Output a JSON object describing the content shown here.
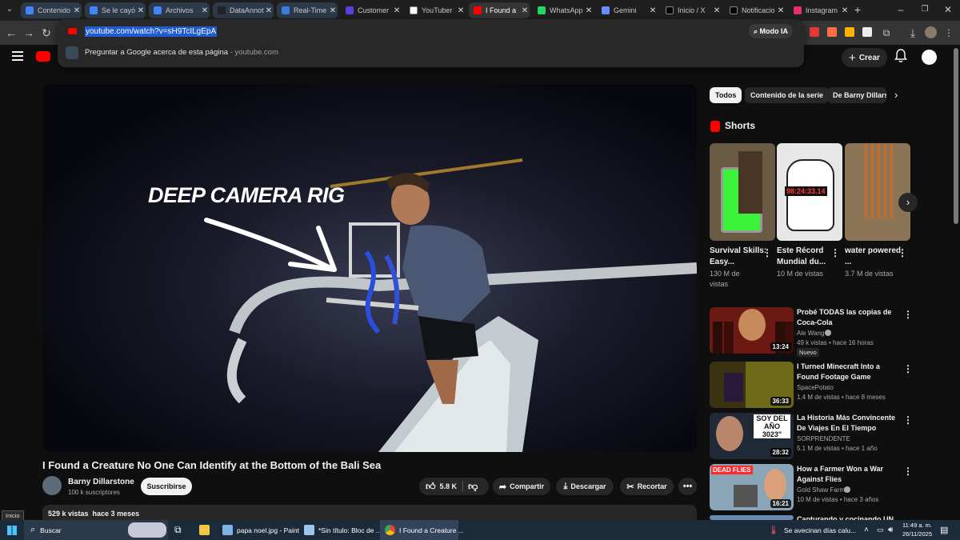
{
  "browser": {
    "tabs": [
      {
        "label": "Contenido",
        "color": "#4285f4"
      },
      {
        "label": "Se le cayó",
        "color": "#4285f4"
      },
      {
        "label": "Archivos",
        "color": "#4285f4"
      },
      {
        "label": "DataAnnot",
        "color": "#222222"
      },
      {
        "label": "Real-Time",
        "color": "#3b7ddd"
      },
      {
        "label": "Customer",
        "color": "#5b3fd6"
      },
      {
        "label": "YouTuber",
        "color": "#ffffff"
      },
      {
        "label": "I Found a",
        "color": "#ff0000"
      },
      {
        "label": "WhatsApp",
        "color": "#25d366"
      },
      {
        "label": "Gemini",
        "color": "#6a8cff"
      },
      {
        "label": "Inicio / X",
        "color": "#000000"
      },
      {
        "label": "Notificacio",
        "color": "#000000"
      },
      {
        "label": "Instagram",
        "color": "#e1306c"
      }
    ],
    "url": "youtube.com/watch?v=sH9TcILgEpA",
    "suggestion": "Preguntar a Google acerca de esta página",
    "suggestion_domain": "- youtube.com",
    "modo_ia": "Modo IA"
  },
  "youtube": {
    "create_label": "Crear",
    "video": {
      "overlay_text": "DEEP CAMERA RIG",
      "title": "I Found a Creature No One Can Identify at the Bottom of the Bali Sea",
      "channel": "Barny Dillarstone",
      "subscribers": "100 k suscriptores",
      "subscribe_label": "Suscribirse",
      "likes": "5.8 K",
      "share_label": "Compartir",
      "download_label": "Descargar",
      "clip_label": "Recortar",
      "views_date": "529 k vistas  hace 3 meses"
    },
    "chips": [
      "Todos",
      "Contenido de la serie",
      "De Barny Dillarst"
    ],
    "shorts_heading": "Shorts",
    "shorts": [
      {
        "title": "Survival Skills: Easy...",
        "views": "130 M de vistas"
      },
      {
        "title": "Este Récord Mundial du...",
        "views": "10 M de vistas",
        "timer": "98:24:33.14"
      },
      {
        "title": "water powered ...",
        "views": "3.7 M de vistas"
      }
    ],
    "recommendations": [
      {
        "title": "Probé TODAS las copias de Coca-Cola",
        "channel": "Ale Wang",
        "meta": "49 k vistas • hace 16 horas",
        "badge": "Nuevo",
        "duration": "13:24"
      },
      {
        "title": "I Turned Minecraft Into a Found Footage Game",
        "channel": "SpacePotato",
        "meta": "1.4 M de vistas • hace 8 meses",
        "duration": "36:33"
      },
      {
        "title": "La Historia Más Convincente De Viajes En El Tiempo",
        "channel": "SORPRENDENTE",
        "meta": "5.1 M de vistas • hace 1 año",
        "duration": "28:32",
        "thumb_text": "SOY DEL AÑO 3023\""
      },
      {
        "title": "How a Farmer Won a War Against Flies",
        "channel": "Gold Shaw Farm",
        "meta": "10 M de vistas • hace 3 años",
        "duration": "16:21",
        "thumb_text": "DEAD FLIES"
      },
      {
        "title": "Capturando y cocinando UN"
      }
    ]
  },
  "tooltip": "Inicio",
  "taskbar": {
    "search": "Buscar",
    "apps": [
      "papa noel.jpg - Paint",
      "*Sin título: Bloc de ...",
      "I Found a Creature ..."
    ],
    "weather": "Se avecinan días calu...",
    "time": "11:49 a. m.",
    "date": "26/11/2025"
  }
}
